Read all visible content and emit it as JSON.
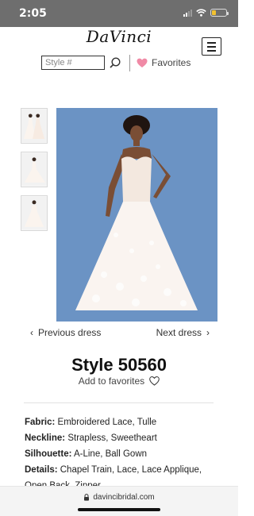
{
  "status_bar": {
    "time": "2:05"
  },
  "header": {
    "logo_text": "DaVinci",
    "menu_icon": "hamburger-menu-icon",
    "search_placeholder": "Style #",
    "search_icon": "search-icon",
    "favorites_label": "Favorites",
    "favorites_icon": "heart-icon",
    "heart_color": "#f08aa6"
  },
  "gallery": {
    "thumbnails": [
      {
        "icon": "dress-front-thumbnail"
      },
      {
        "icon": "dress-back-thumbnail"
      },
      {
        "icon": "dress-front-thumbnail"
      }
    ],
    "photo_bg": "#6b93c4"
  },
  "navigation": {
    "previous_label": "Previous dress",
    "next_label": "Next dress"
  },
  "product": {
    "title": "Style 50560",
    "add_to_favorites": "Add to favorites",
    "details": [
      {
        "label": "Fabric:",
        "value": "Embroidered Lace, Tulle"
      },
      {
        "label": "Neckline:",
        "value": "Strapless, Sweetheart"
      },
      {
        "label": "Silhouette:",
        "value": "A-Line, Ball Gown"
      },
      {
        "label": "Details:",
        "value": "Chapel Train, Lace, Lace Applique, Open Back, Zipper"
      }
    ]
  },
  "browser": {
    "url": "davincibridal.com",
    "lock_icon": "lock-icon"
  }
}
